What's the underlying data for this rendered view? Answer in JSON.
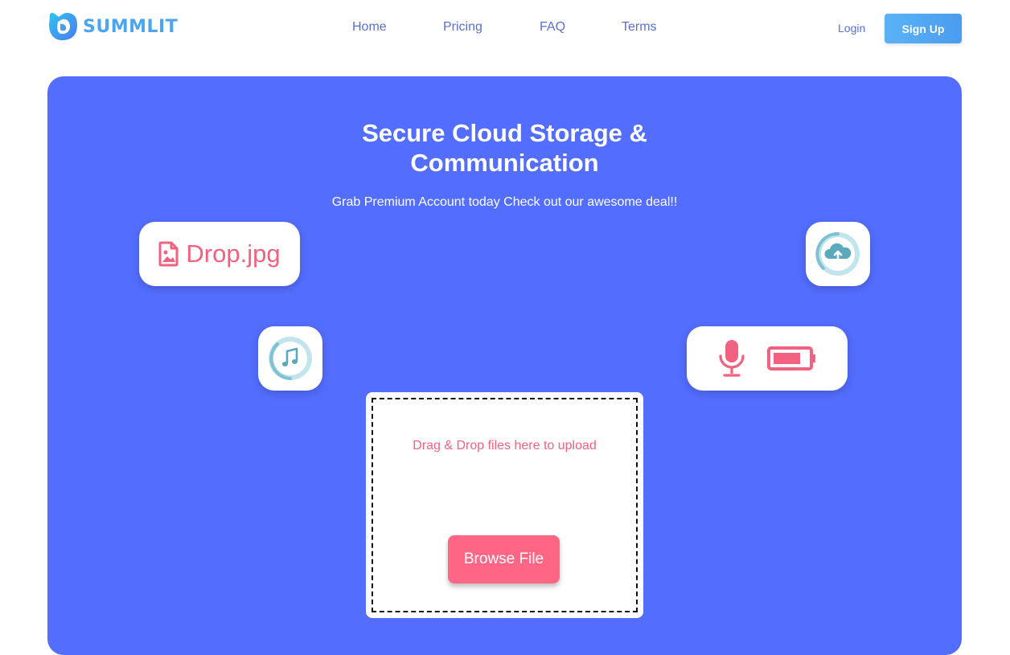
{
  "brand": {
    "name": "SUMMLIT",
    "logo_icon": "summlit-logo-icon",
    "color": "#4aa6f4"
  },
  "nav": {
    "items": [
      {
        "label": "Home"
      },
      {
        "label": "Pricing"
      },
      {
        "label": "FAQ"
      },
      {
        "label": "Terms"
      }
    ]
  },
  "auth": {
    "login_label": "Login",
    "signup_label": "Sign Up"
  },
  "hero": {
    "title_line1": "Secure Cloud Storage &",
    "title_line2": "Communication",
    "subtitle": "Grab Premium Account today Check out our awesome deal!!",
    "background": "#536dfe"
  },
  "cards": {
    "file_name": "Drop.jpg",
    "file_icon": "image-file-icon",
    "cloud_icon": "cloud-upload-icon",
    "music_icon": "music-note-icon",
    "mic_icon": "microphone-icon",
    "battery_icon": "battery-icon"
  },
  "upload": {
    "drop_text": "Drag & Drop files here to upload",
    "browse_label": "Browse File",
    "accent": "#ff6584"
  }
}
